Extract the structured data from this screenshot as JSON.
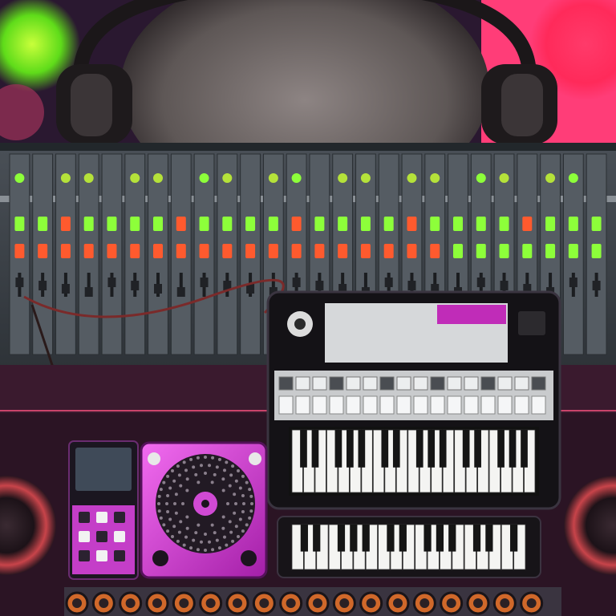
{
  "scene": {
    "background_colors": [
      "#2a0f2a",
      "#ff2f6b",
      "#7cff2a",
      "#3a1b2f"
    ],
    "accent_magenta": "#e040e8",
    "led_green": "#8dff3a",
    "led_red": "#ff5a2e",
    "panel_gray": "#6d7378"
  },
  "console": {
    "channel_count": 26,
    "fader_count": 26
  },
  "keyboards": {
    "upper_white_keys": 21,
    "lower_white_keys": 19
  },
  "knob_row": {
    "knob_count": 18
  }
}
